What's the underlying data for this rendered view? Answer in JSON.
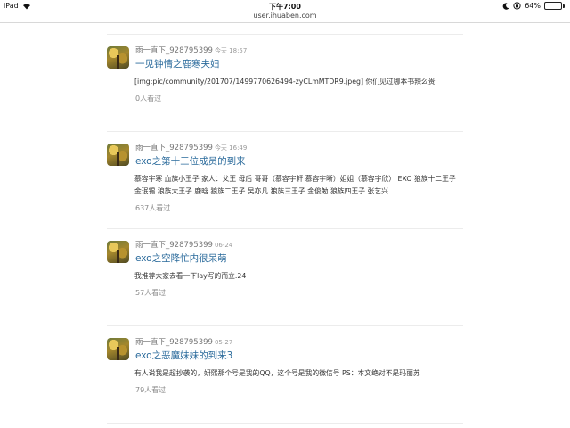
{
  "status_bar": {
    "device": "iPad",
    "time": "下午7:00",
    "battery": "64%",
    "battery_level": 0.64
  },
  "url": "user.ihuaben.com",
  "posts": [
    {
      "author": "雨一直下_928795399",
      "time": "今天 18:57",
      "title": "一见钟情之鹿寒夫妇",
      "excerpt": "[img:pic/community/201707/1499770626494-zyCLmMTDR9.jpeg] 你们见过哪本书辣么贵",
      "views": "0人看过"
    },
    {
      "author": "雨一直下_928795399",
      "time": "今天 16:49",
      "title": "exo之第十三位成员的到来",
      "excerpt": "慕容宇寒 血族小王子 家人：父王 母后 哥哥（慕容宇轩 慕容宇晰）姐姐（慕容宇欣） EXO 狼族十二王子 金珉锡 狼族大王子 鹿晗 狼族二王子 吴亦凡 狼族三王子 金俊勉 狼族四王子 张艺兴...",
      "views": "637人看过"
    },
    {
      "author": "雨一直下_928795399",
      "time": "06-24",
      "title": "exo之空降忙内很呆萌",
      "excerpt": "我推荐大家去看一下lay写的而立.24",
      "views": "57人看过"
    },
    {
      "author": "雨一直下_928795399",
      "time": "05-27",
      "title": "exo之恶魔妹妹的到来3",
      "excerpt": "有人说我是超抄袭的，妍熙那个号是我的QQ，这个号是我的微信号 PS：本文绝对不是玛丽苏",
      "views": "79人看过"
    }
  ]
}
